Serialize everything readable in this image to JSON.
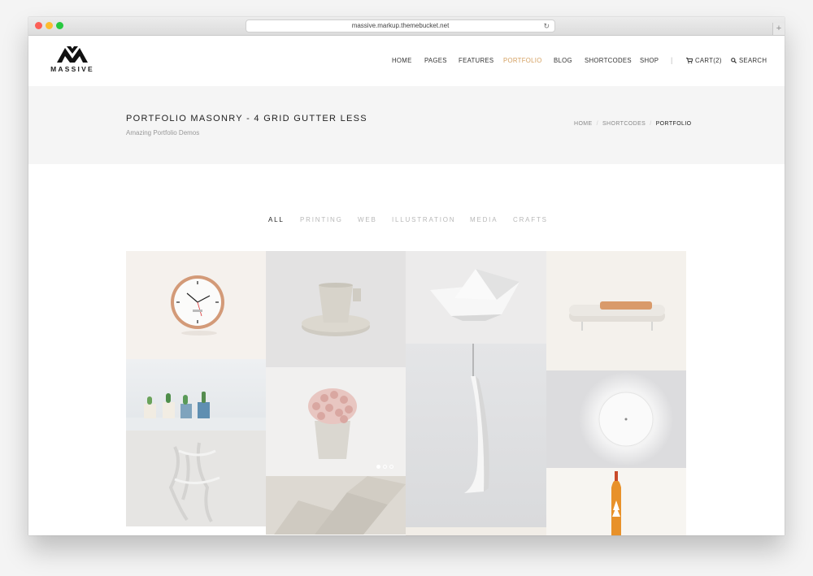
{
  "browser": {
    "url": "massive.markup.themebucket.net"
  },
  "logo": {
    "text": "MASSIVE"
  },
  "nav": {
    "items": [
      "HOME",
      "PAGES",
      "FEATURES",
      "PORTFOLIO",
      "BLOG",
      "SHORTCODES",
      "SHOP"
    ],
    "active": "PORTFOLIO",
    "cart_label": "CART(2)",
    "search_label": "SEARCH"
  },
  "banner": {
    "title": "PORTFOLIO MASONRY - 4 GRID GUTTER LESS",
    "subtitle": "Amazing Portfolio Demos",
    "breadcrumb": [
      "HOME",
      "SHORTCODES",
      "PORTFOLIO"
    ]
  },
  "filters": {
    "items": [
      "ALL",
      "PRINTING",
      "WEB",
      "ILLUSTRATION",
      "MEDIA",
      "CRAFTS"
    ],
    "active": "ALL"
  },
  "gallery": {
    "items": [
      "wall-clock",
      "ceramic-cup",
      "paper-boat",
      "bench-tray",
      "cactus-pots",
      "draped-fabric",
      "flower-vase",
      "pendant-lamp",
      "wall-light",
      "business-cards",
      "juice-bottle"
    ]
  },
  "colors": {
    "accent": "#d4a060",
    "banner_bg": "#f5f5f5"
  }
}
